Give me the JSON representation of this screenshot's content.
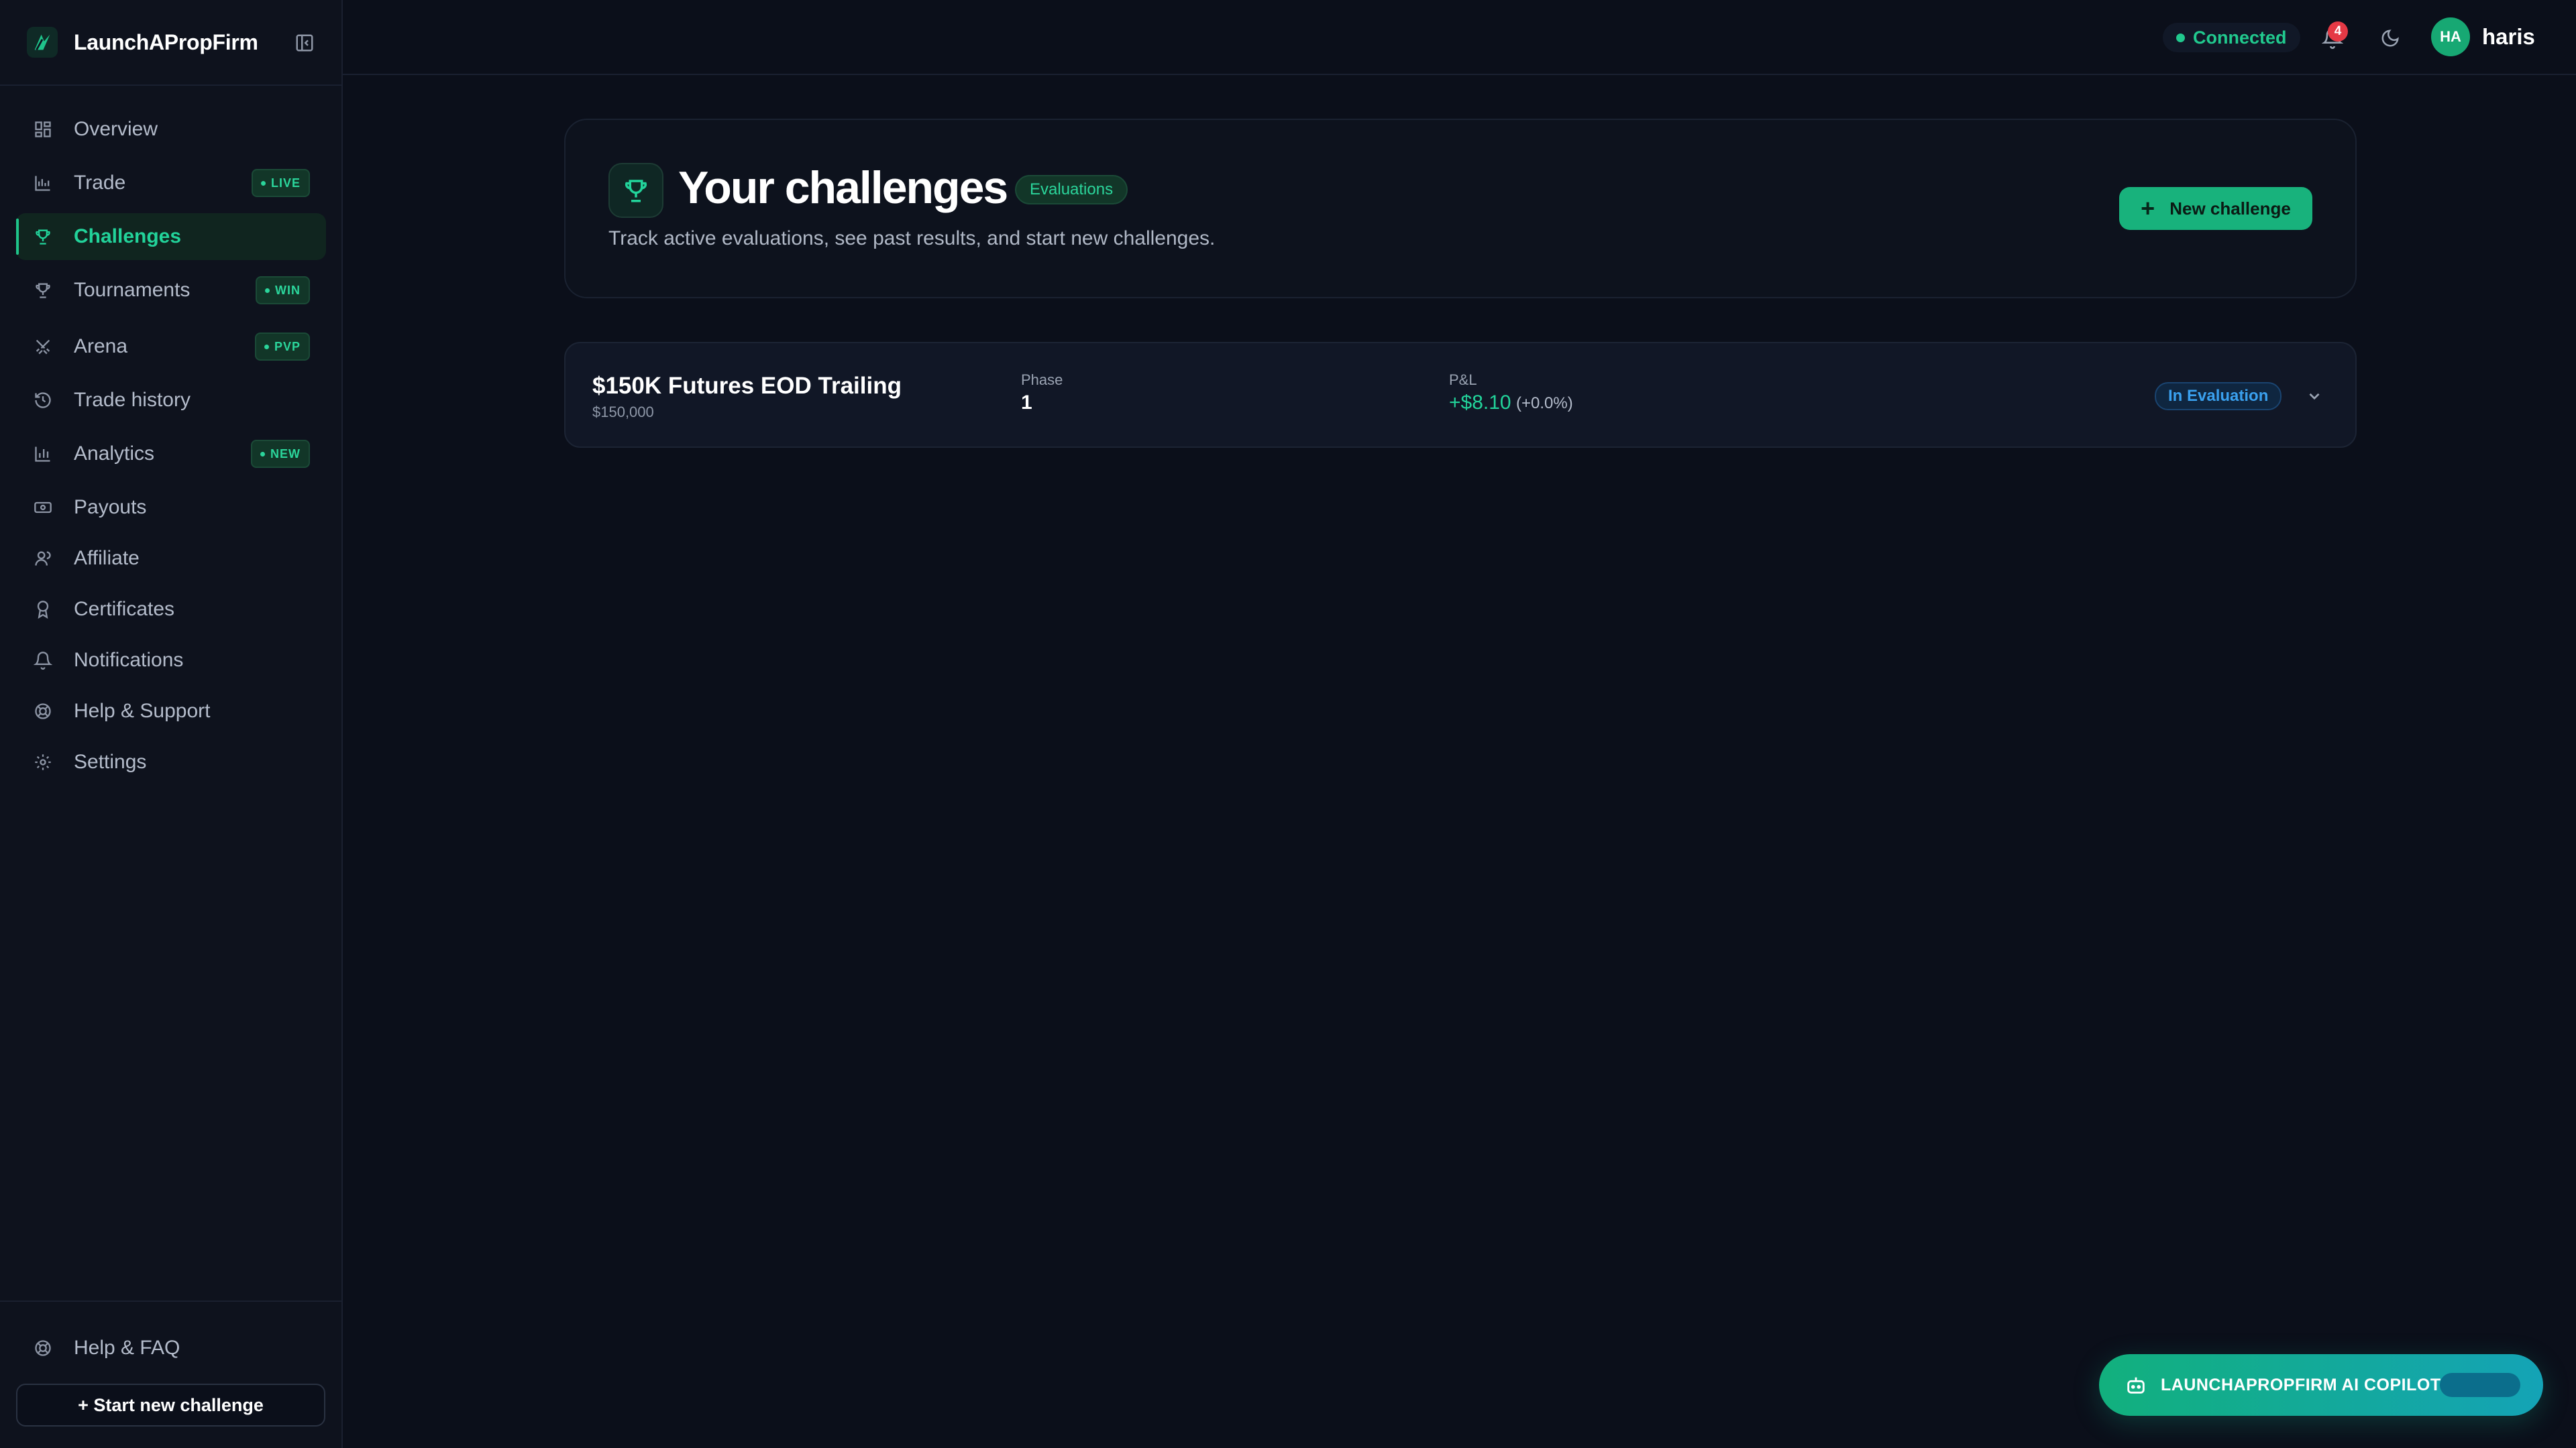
{
  "brand": {
    "name": "LaunchAPropFirm"
  },
  "sidebar": {
    "items": [
      {
        "label": "Overview",
        "icon": "grid-icon"
      },
      {
        "label": "Trade",
        "icon": "chart-icon",
        "badge": "LIVE"
      },
      {
        "label": "Challenges",
        "icon": "trophy-icon",
        "active": true
      },
      {
        "label": "Tournaments",
        "icon": "trophy-icon",
        "badge": "WIN"
      },
      {
        "label": "Arena",
        "icon": "swords-icon",
        "badge": "PVP"
      },
      {
        "label": "Trade history",
        "icon": "history-icon"
      },
      {
        "label": "Analytics",
        "icon": "bar-chart-icon",
        "badge": "NEW"
      },
      {
        "label": "Payouts",
        "icon": "banknote-icon"
      },
      {
        "label": "Affiliate",
        "icon": "users-icon"
      },
      {
        "label": "Certificates",
        "icon": "award-icon"
      },
      {
        "label": "Notifications",
        "icon": "bell-icon"
      },
      {
        "label": "Help & Support",
        "icon": "lifebuoy-icon"
      },
      {
        "label": "Settings",
        "icon": "gear-icon"
      }
    ],
    "help_faq": "Help & FAQ",
    "start_button": "+ Start new challenge"
  },
  "topbar": {
    "status": "Connected",
    "notification_count": "4",
    "avatar_initials": "HA",
    "username": "haris"
  },
  "hero": {
    "title": "Your challenges",
    "badge": "Evaluations",
    "subtitle": "Track active evaluations, see past results, and start new challenges.",
    "new_button": "New challenge"
  },
  "challenges": [
    {
      "name": "$150K Futures EOD Trailing",
      "size": "$150,000",
      "phase_label": "Phase",
      "phase": "1",
      "pnl_label": "P&L",
      "pnl": "+$8.10",
      "pnl_pct": "(+0.0%)",
      "status": "In Evaluation"
    }
  ],
  "copilot": {
    "label": "LAUNCHAPROPFIRM AI COPILOT"
  },
  "colors": {
    "accent": "#1fc48b",
    "background": "#0b0f1a",
    "status_blue": "#3aa0ee",
    "notification_red": "#e53945"
  }
}
